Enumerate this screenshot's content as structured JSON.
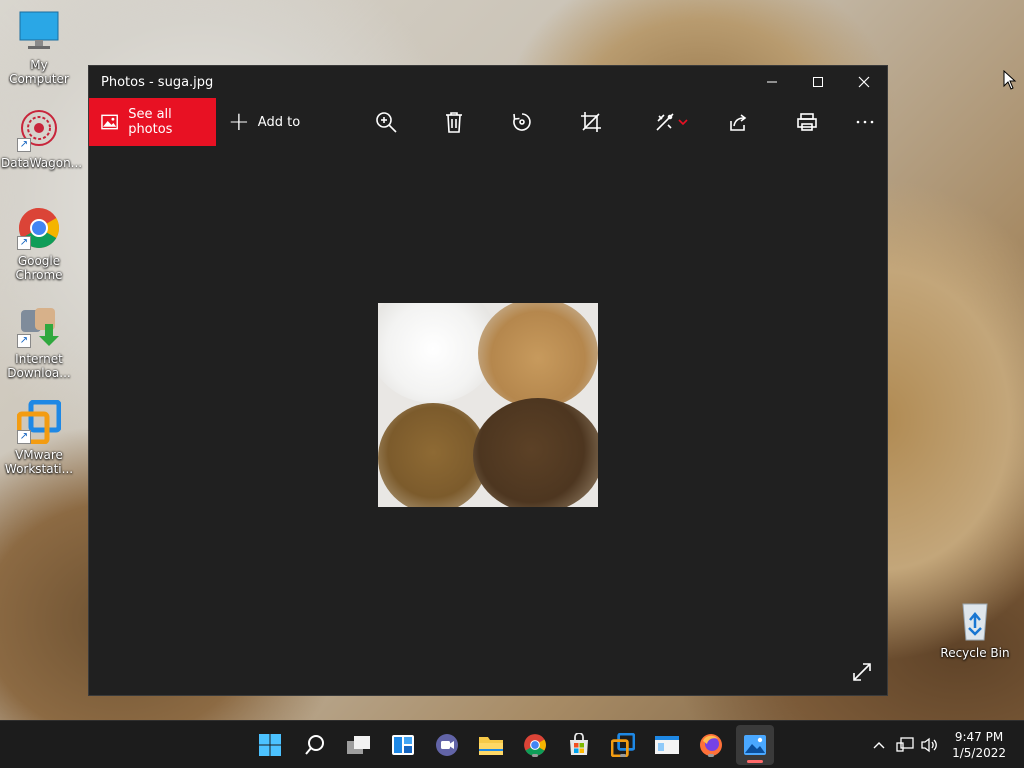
{
  "desktop": {
    "icons": [
      {
        "label": "My Computer"
      },
      {
        "label": "DataWagon..."
      },
      {
        "label": "Google Chrome"
      },
      {
        "label": "Internet Downloa..."
      },
      {
        "label": "VMware Workstati..."
      },
      {
        "label": "Recycle Bin"
      }
    ]
  },
  "window": {
    "title": "Photos - suga.jpg",
    "toolbar": {
      "see_all": "See all photos",
      "add_to": "Add to"
    },
    "accent": "#e81123"
  },
  "taskbar": {
    "time": "9:47 PM",
    "date": "1/5/2022"
  }
}
